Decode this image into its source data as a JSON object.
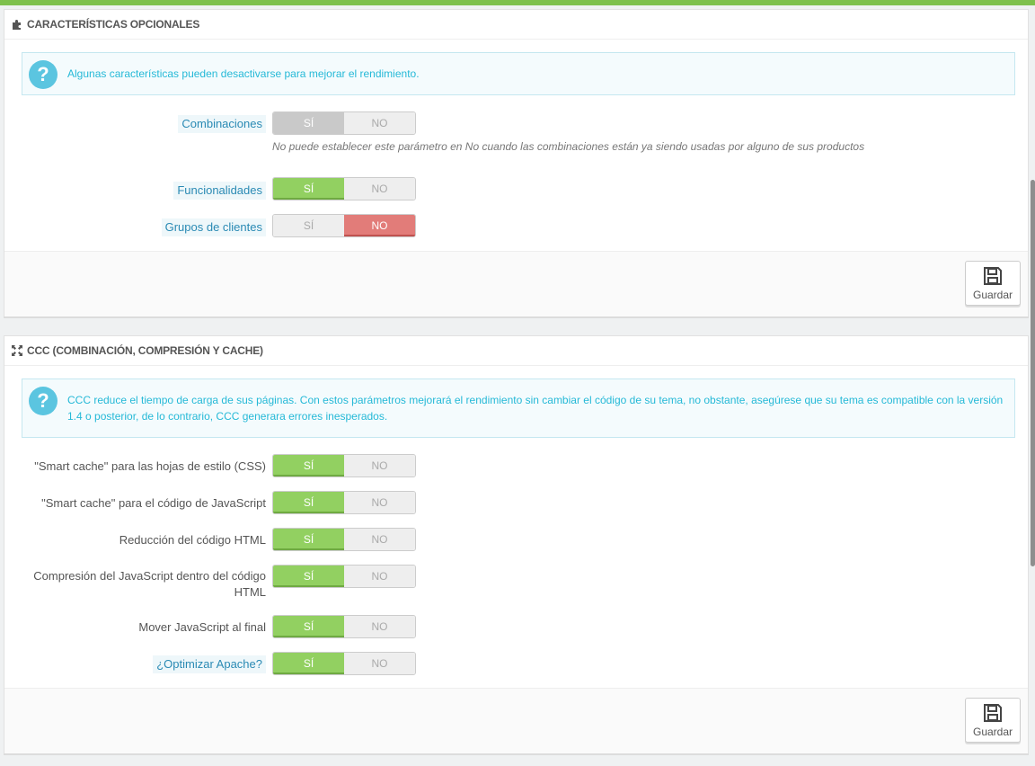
{
  "panels": [
    {
      "title": "CARACTERÍSTICAS OPCIONALES",
      "icon": "puzzle-icon",
      "alert": "Algunas características pueden desactivarse para mejorar el rendimiento.",
      "rows": [
        {
          "label": "Combinaciones",
          "yes": "SÍ",
          "no": "NO",
          "state": "disabled-yes",
          "note": "No puede establecer este parámetro en No cuando las combinaciones están ya siendo usadas por alguno de sus productos"
        },
        {
          "label": "Funcionalidades",
          "yes": "SÍ",
          "no": "NO",
          "state": "yes"
        },
        {
          "label": "Grupos de clientes",
          "yes": "SÍ",
          "no": "NO",
          "state": "no"
        }
      ],
      "save_label": "Guardar"
    },
    {
      "title": "CCC (COMBINACIÓN, COMPRESIÓN Y CACHE)",
      "icon": "fullscreen-icon",
      "alert": "CCC reduce el tiempo de carga de sus páginas. Con estos parámetros mejorará el rendimiento sin cambiar el código de su tema, no obstante, asegúrese que su tema es compatible con la versión 1.4 o posterior, de lo contrario, CCC generara errores inesperados.",
      "rows": [
        {
          "label": "\"Smart cache\" para las hojas de estilo (CSS)",
          "yes": "SÍ",
          "no": "NO",
          "state": "yes"
        },
        {
          "label": "\"Smart cache\" para el código de JavaScript",
          "yes": "SÍ",
          "no": "NO",
          "state": "yes"
        },
        {
          "label": "Reducción del código HTML",
          "yes": "SÍ",
          "no": "NO",
          "state": "yes"
        },
        {
          "label": "Compresión del JavaScript dentro del código HTML",
          "yes": "SÍ",
          "no": "NO",
          "state": "yes"
        },
        {
          "label": "Mover JavaScript al final",
          "yes": "SÍ",
          "no": "NO",
          "state": "yes"
        },
        {
          "label": "¿Optimizar Apache?",
          "yes": "SÍ",
          "no": "NO",
          "state": "yes"
        }
      ],
      "save_label": "Guardar"
    }
  ],
  "colors": {
    "accent_green": "#92d061",
    "accent_red": "#e27c79",
    "info_blue": "#25b9d7"
  }
}
